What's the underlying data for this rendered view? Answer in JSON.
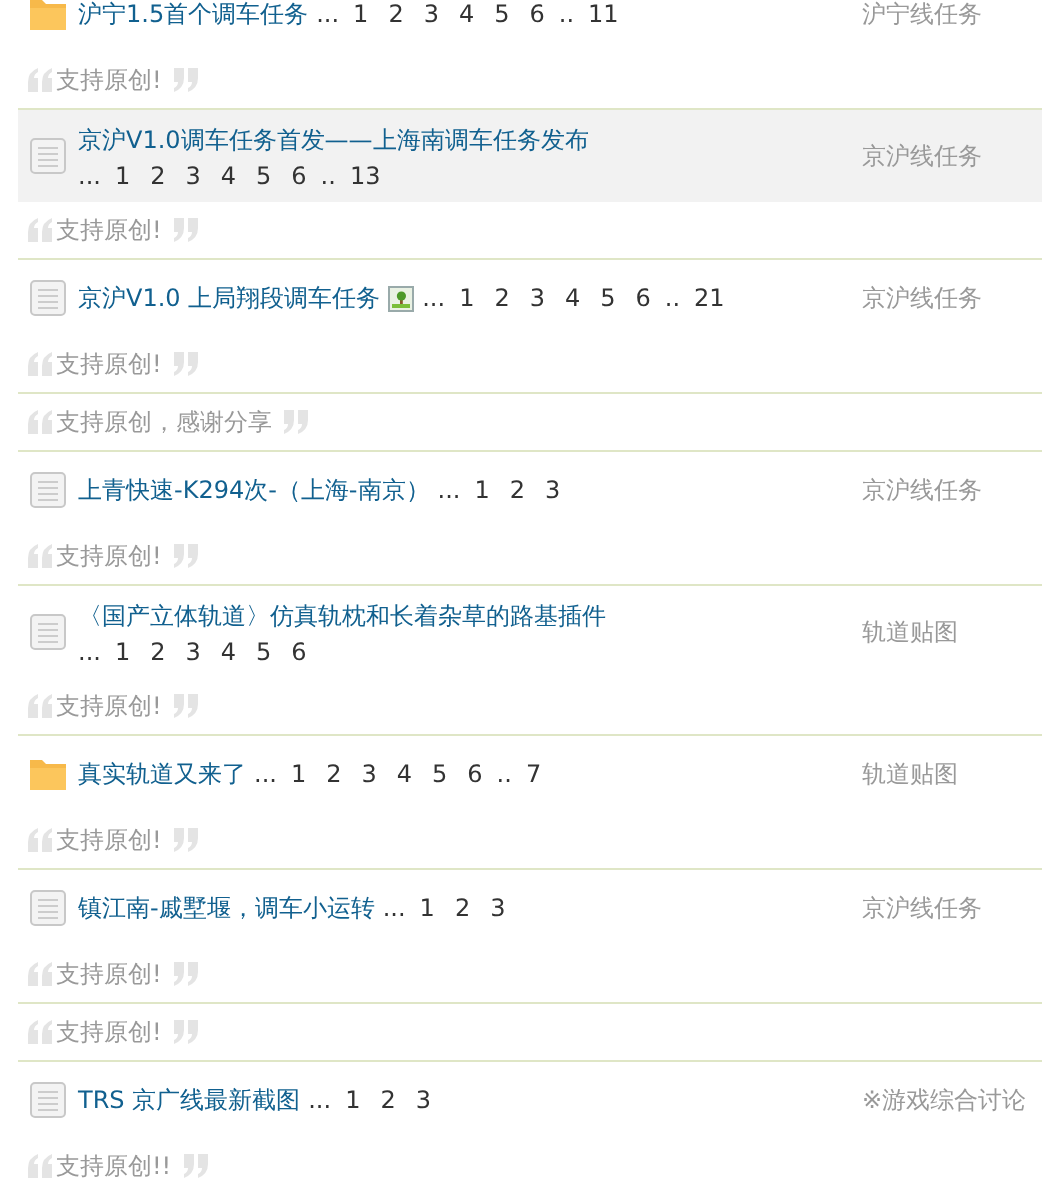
{
  "posts": [
    {
      "thread": {
        "kind": "folder",
        "title": "沪宁1.5首个调车任务",
        "attachment": false,
        "highlighted": false,
        "wrap": false,
        "lead": "...",
        "pages": [
          "1",
          "2",
          "3",
          "4",
          "5",
          "6"
        ],
        "gap": "..",
        "last": "11",
        "category": "沪宁线任务"
      },
      "quote": "支持原创!"
    },
    {
      "thread": {
        "kind": "doc",
        "title": "京沪V1.0调车任务首发——上海南调车任务发布",
        "attachment": false,
        "highlighted": true,
        "wrap": true,
        "lead": "...",
        "pages": [
          "1",
          "2",
          "3",
          "4",
          "5",
          "6"
        ],
        "gap": "..",
        "last": "13",
        "category": "京沪线任务"
      },
      "quote": "支持原创!"
    },
    {
      "thread": {
        "kind": "doc",
        "title": "京沪V1.0 上局翔段调车任务",
        "attachment": true,
        "highlighted": false,
        "wrap": false,
        "lead": "...",
        "pages": [
          "1",
          "2",
          "3",
          "4",
          "5",
          "6"
        ],
        "gap": "..",
        "last": "21",
        "category": "京沪线任务"
      },
      "quote": "支持原创!"
    },
    {
      "quote": "支持原创，感谢分享"
    },
    {
      "thread": {
        "kind": "doc",
        "title": "上青快速-K294次-（上海-南京）",
        "attachment": false,
        "highlighted": false,
        "wrap": false,
        "lead": "...",
        "pages": [
          "1",
          "2",
          "3"
        ],
        "category": "京沪线任务"
      },
      "quote": "支持原创!"
    },
    {
      "thread": {
        "kind": "doc",
        "title": "〈国产立体轨道〉仿真轨枕和长着杂草的路基插件",
        "attachment": false,
        "highlighted": false,
        "wrap": true,
        "lead": "...",
        "pages": [
          "1",
          "2",
          "3",
          "4",
          "5",
          "6"
        ],
        "category": "轨道贴图"
      },
      "quote": "支持原创!"
    },
    {
      "thread": {
        "kind": "folder",
        "title": "真实轨道又来了",
        "attachment": false,
        "highlighted": false,
        "wrap": false,
        "lead": "...",
        "pages": [
          "1",
          "2",
          "3",
          "4",
          "5",
          "6"
        ],
        "gap": "..",
        "last": "7",
        "category": "轨道贴图"
      },
      "quote": "支持原创!"
    },
    {
      "thread": {
        "kind": "doc",
        "title": "镇江南-戚墅堰，调车小运转",
        "attachment": false,
        "highlighted": false,
        "wrap": false,
        "lead": "...",
        "pages": [
          "1",
          "2",
          "3"
        ],
        "category": "京沪线任务"
      },
      "quote": "支持原创!"
    },
    {
      "quote": "支持原创!"
    },
    {
      "thread": {
        "kind": "doc",
        "title": "TRS 京广线最新截图",
        "attachment": false,
        "highlighted": false,
        "wrap": false,
        "lead": "...",
        "pages": [
          "1",
          "2",
          "3"
        ],
        "category": "※游戏综合讨论"
      },
      "quote": "支持原创!!"
    }
  ]
}
